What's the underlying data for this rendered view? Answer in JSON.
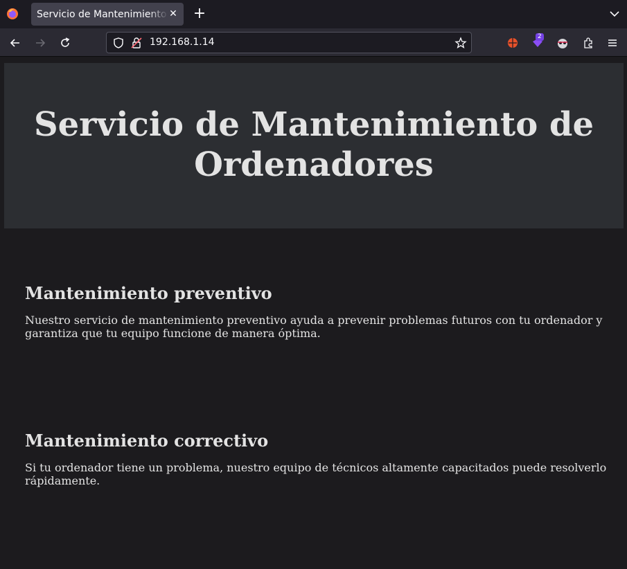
{
  "browser": {
    "tab_title": "Servicio de Mantenimiento de Ordenadores",
    "tab_close": "✕",
    "new_tab": "+",
    "url": "192.168.1.14",
    "extension_badge": "2"
  },
  "page": {
    "heading": "Servicio de Mantenimiento de Ordenadores",
    "sections": [
      {
        "title": "Mantenimiento preventivo",
        "body": "Nuestro servicio de mantenimiento preventivo ayuda a prevenir problemas futuros con tu ordenador y garantiza que tu equipo funcione de manera óptima."
      },
      {
        "title": "Mantenimiento correctivo",
        "body": "Si tu ordenador tiene un problema, nuestro equipo de técnicos altamente capacitados puede resolverlo rápidamente."
      }
    ]
  },
  "colors": {
    "chrome_bg": "#1c1b22",
    "toolbar_bg": "#2b2a33",
    "hero_bg": "#2c2e32",
    "page_bg": "#1c1b1e",
    "text": "#e3e3e3"
  }
}
